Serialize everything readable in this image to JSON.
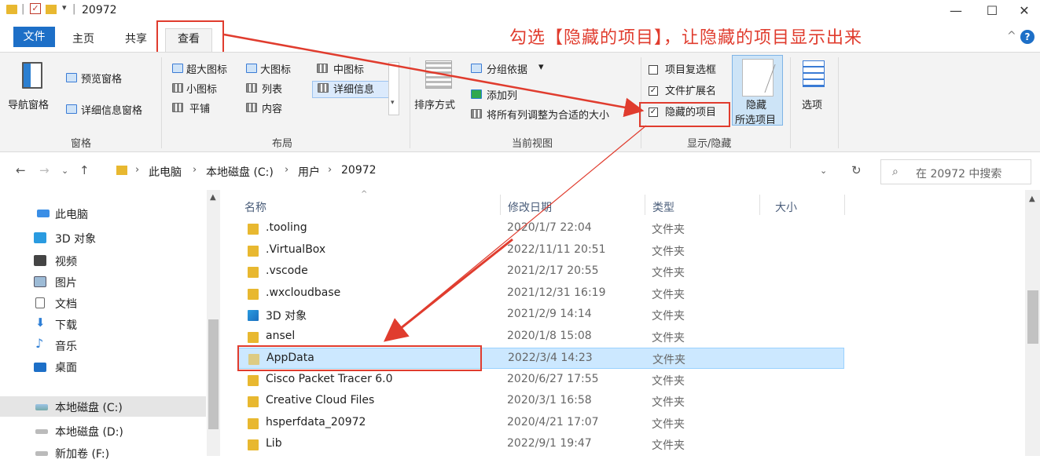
{
  "window": {
    "title": "20972",
    "minimize": "—",
    "maximize": "☐",
    "close": "✕"
  },
  "tabs": {
    "file": "文件",
    "home": "主页",
    "share": "共享",
    "view": "查看"
  },
  "annotation": {
    "instruction": "勾选【隐藏的项目】，让隐藏的项目显示出来",
    "color": "#e03c2e"
  },
  "ribbon": {
    "panes": {
      "nav_pane": "导航窗格",
      "preview_pane": "预览窗格",
      "details_pane": "详细信息窗格",
      "group": "窗格"
    },
    "layout": {
      "extra_large": "超大图标",
      "large": "大图标",
      "medium": "中图标",
      "small": "小图标",
      "list": "列表",
      "details": "详细信息",
      "tiles": "平铺",
      "content": "内容",
      "group": "布局"
    },
    "current_view": {
      "sort_by": "排序方式",
      "group_by": "分组依据",
      "add_column": "添加列",
      "fit_columns": "将所有列调整为合适的大小",
      "group": "当前视图"
    },
    "show_hide": {
      "item_checkboxes": "项目复选框",
      "file_extensions": "文件扩展名",
      "hidden_items": "隐藏的项目",
      "hide_selected_line1": "隐藏",
      "hide_selected_line2": "所选项目",
      "options": "选项",
      "group": "显示/隐藏",
      "item_checkboxes_checked": false,
      "file_extensions_checked": true,
      "hidden_items_checked": true
    }
  },
  "address": {
    "crumbs": [
      "此电脑",
      "本地磁盘 (C:)",
      "用户",
      "20972"
    ],
    "search_placeholder": "在 20972 中搜索"
  },
  "nav": {
    "items": [
      {
        "label": "此电脑",
        "icon": "computer-icon"
      },
      {
        "label": "3D 对象",
        "icon": "3d-objects-icon"
      },
      {
        "label": "视频",
        "icon": "video-icon"
      },
      {
        "label": "图片",
        "icon": "pictures-icon"
      },
      {
        "label": "文档",
        "icon": "documents-icon"
      },
      {
        "label": "下载",
        "icon": "download-icon"
      },
      {
        "label": "音乐",
        "icon": "music-icon"
      },
      {
        "label": "桌面",
        "icon": "desktop-icon"
      },
      {
        "label": "本地磁盘 (C:)",
        "icon": "drive-c-icon"
      },
      {
        "label": "本地磁盘 (D:)",
        "icon": "drive-d-icon"
      },
      {
        "label": "新加卷 (F:)",
        "icon": "drive-f-icon"
      }
    ]
  },
  "columns": {
    "name": "名称",
    "modified": "修改日期",
    "type": "类型",
    "size": "大小"
  },
  "files": [
    {
      "name": ".tooling",
      "date": "2020/1/7 22:04",
      "type": "文件夹"
    },
    {
      "name": ".VirtualBox",
      "date": "2022/11/11 20:51",
      "type": "文件夹"
    },
    {
      "name": ".vscode",
      "date": "2021/2/17 20:55",
      "type": "文件夹"
    },
    {
      "name": ".wxcloudbase",
      "date": "2021/12/31 16:19",
      "type": "文件夹"
    },
    {
      "name": "3D 对象",
      "date": "2021/2/9 14:14",
      "type": "文件夹"
    },
    {
      "name": "ansel",
      "date": "2020/1/8 15:08",
      "type": "文件夹"
    },
    {
      "name": "AppData",
      "date": "2022/3/4 14:23",
      "type": "文件夹"
    },
    {
      "name": "Cisco Packet Tracer 6.0",
      "date": "2020/6/27 17:55",
      "type": "文件夹"
    },
    {
      "name": "Creative Cloud Files",
      "date": "2020/3/1 16:58",
      "type": "文件夹"
    },
    {
      "name": "hsperfdata_20972",
      "date": "2020/4/21 17:07",
      "type": "文件夹"
    },
    {
      "name": "Lib",
      "date": "2022/9/1 19:47",
      "type": "文件夹"
    }
  ]
}
